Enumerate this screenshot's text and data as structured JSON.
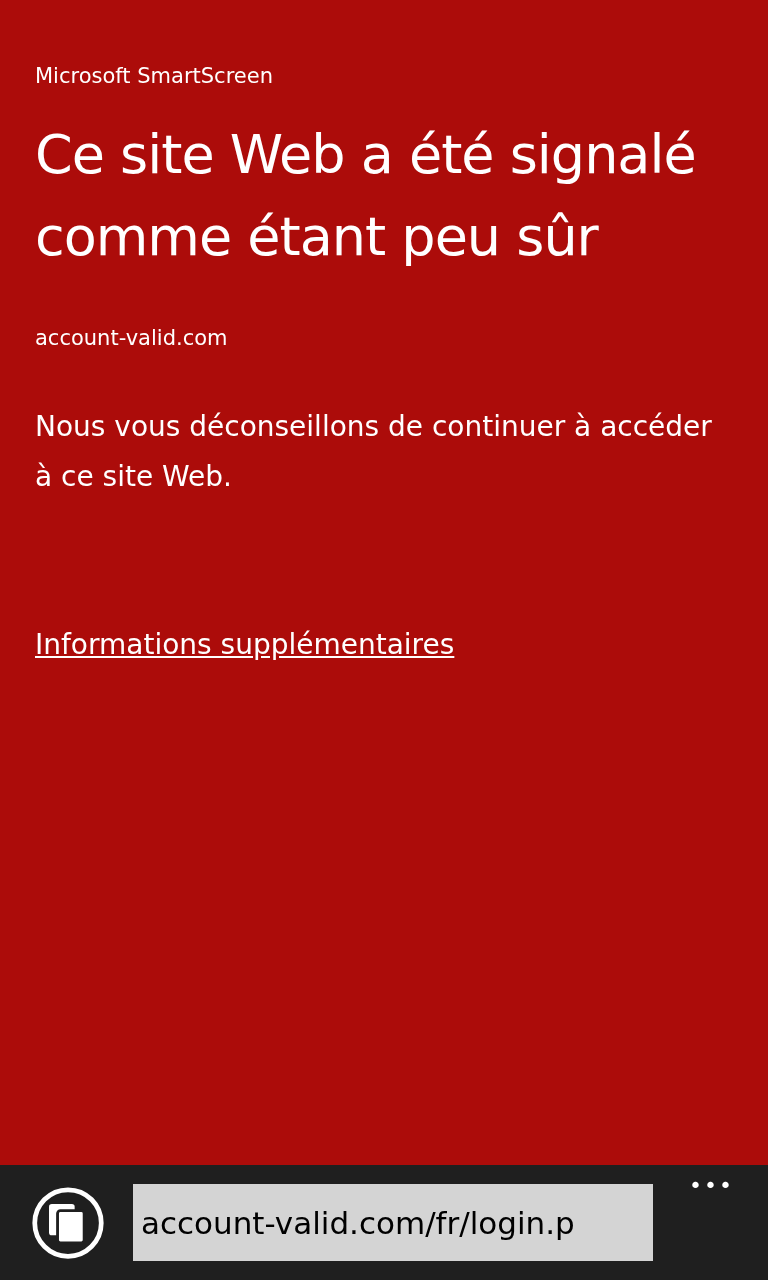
{
  "app_title": "Microsoft SmartScreen",
  "heading": "Ce site Web a été signalé comme étant peu sûr",
  "domain": "account-valid.com",
  "message": "Nous vous déconseillons de continuer à accéder à ce site Web.",
  "more_info_link": "Informations supplémentaires",
  "address_bar": {
    "value": "account-valid.com/fr/login.p"
  },
  "menu_button": "•••"
}
